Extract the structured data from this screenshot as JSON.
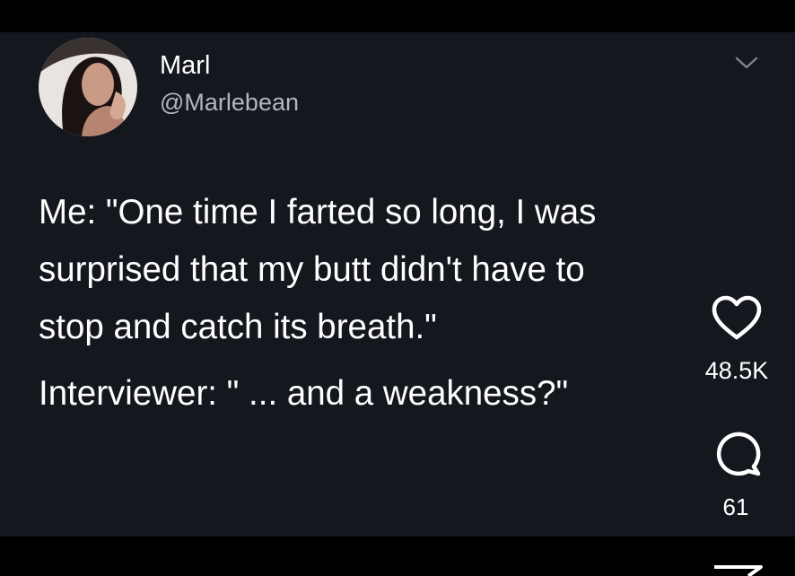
{
  "author": {
    "display_name": "Marl",
    "handle": "@Marlebean",
    "avatar_icon": "profile-photo"
  },
  "tweet": {
    "lines": [
      "Me: \"One time I farted so long, I was",
      "surprised that my butt didn't have to",
      "stop and catch its breath.\"",
      "Interviewer: \" ... and a weakness?\""
    ]
  },
  "actions": {
    "like_icon": "heart-icon",
    "like_count": "48.5K",
    "reply_icon": "comment-icon",
    "reply_count": "61",
    "more_icon": "chevron-down-icon",
    "share_icon": "send-icon"
  },
  "colors": {
    "card_background": "#15171f",
    "page_background": "#000000",
    "primary_text": "#ffffff",
    "secondary_text": "#b4b6bd"
  }
}
